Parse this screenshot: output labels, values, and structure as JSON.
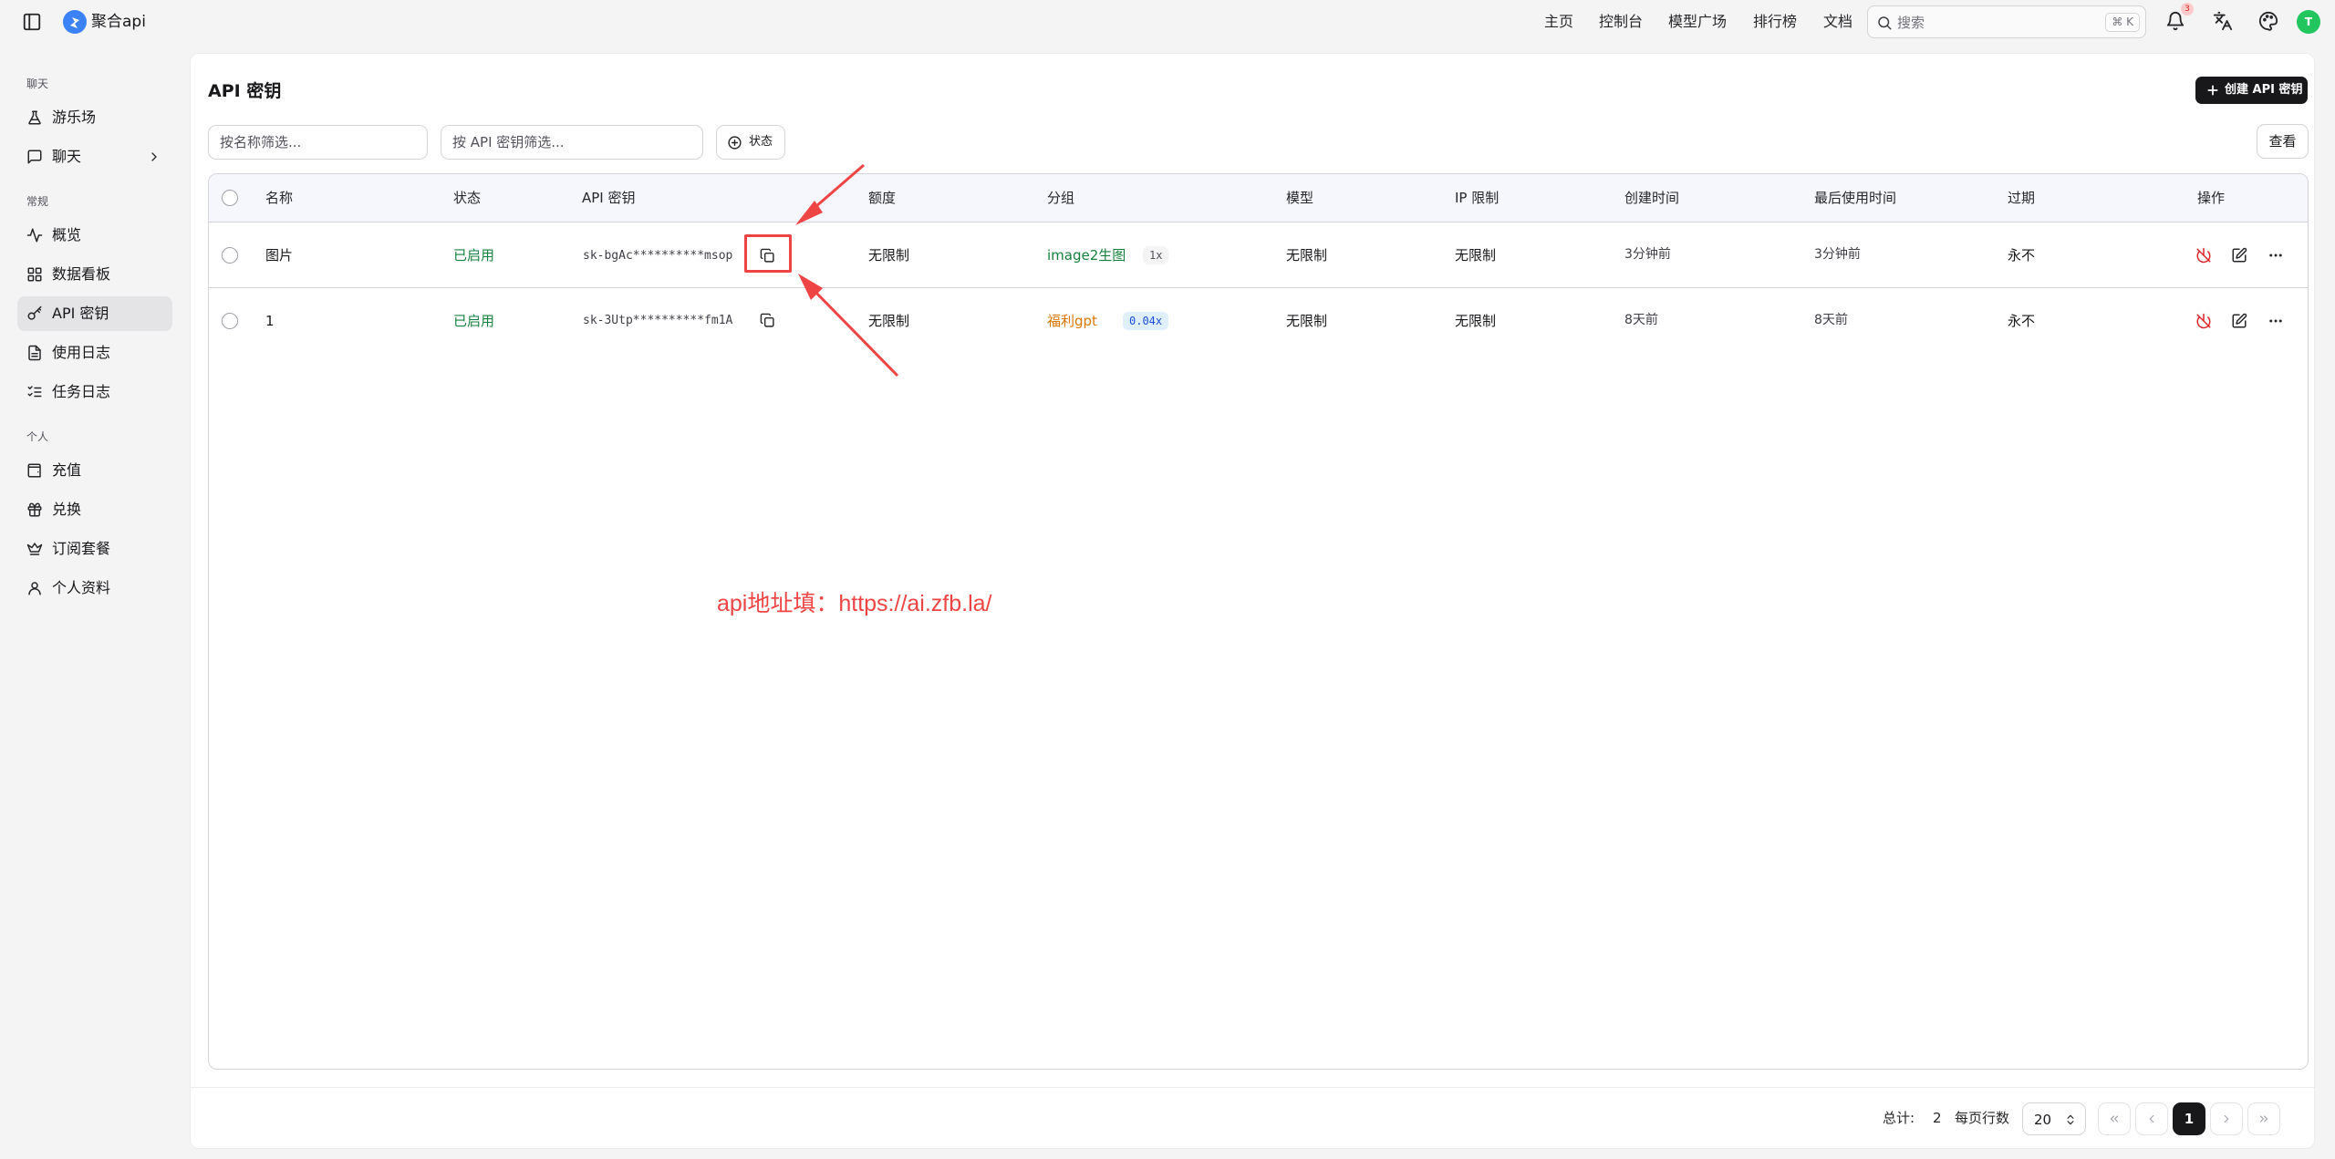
{
  "topbar": {
    "brand": "聚合api",
    "nav": [
      "主页",
      "控制台",
      "模型广场",
      "排行榜",
      "文档"
    ],
    "search_placeholder": "搜索",
    "search_shortcut": "⌘ K",
    "notification_count": "3",
    "avatar_letter": "T"
  },
  "sidebar": {
    "groups": [
      "聊天",
      "常规",
      "个人"
    ],
    "items": [
      {
        "label": "游乐场",
        "icon": "flask-icon"
      },
      {
        "label": "聊天",
        "icon": "message-icon"
      },
      {
        "label": "概览",
        "icon": "activity-icon"
      },
      {
        "label": "数据看板",
        "icon": "dashboard-icon"
      },
      {
        "label": "API 密钥",
        "icon": "key-icon"
      },
      {
        "label": "使用日志",
        "icon": "file-text-icon"
      },
      {
        "label": "任务日志",
        "icon": "list-checks-icon"
      },
      {
        "label": "充值",
        "icon": "wallet-icon"
      },
      {
        "label": "兑换",
        "icon": "gift-icon"
      },
      {
        "label": "订阅套餐",
        "icon": "crown-icon"
      },
      {
        "label": "个人资料",
        "icon": "user-icon"
      }
    ]
  },
  "page": {
    "title": "API 密钥",
    "create_button": "创建 API 密钥",
    "filter_name_placeholder": "按名称筛选...",
    "filter_key_placeholder": "按 API 密钥筛选...",
    "status_button": "状态",
    "view_button": "查看"
  },
  "table": {
    "headers": [
      "名称",
      "状态",
      "API 密钥",
      "额度",
      "分组",
      "模型",
      "IP 限制",
      "创建时间",
      "最后使用时间",
      "过期",
      "操作"
    ],
    "rows": [
      {
        "name": "图片",
        "status": "已启用",
        "key": "sk-bgAc**********msop",
        "quota": "无限制",
        "group": "image2生图",
        "ratio": "1x",
        "models": "无限制",
        "ip": "无限制",
        "created": "3分钟前",
        "last_used": "3分钟前",
        "expire": "永不"
      },
      {
        "name": "1",
        "status": "已启用",
        "key": "sk-3Utp**********fm1A",
        "quota": "无限制",
        "group": "福利gpt",
        "ratio": "0.04x",
        "models": "无限制",
        "ip": "无限制",
        "created": "8天前",
        "last_used": "8天前",
        "expire": "永不"
      }
    ]
  },
  "annotation": {
    "text": "api地址填：https://ai.zfb.la/",
    "color": "#ef4444"
  },
  "footer": {
    "total_label": "总计:",
    "total_value": "2",
    "rows_per_page_label": "每页行数",
    "rows_per_page_value": "20",
    "current_page": "1"
  }
}
